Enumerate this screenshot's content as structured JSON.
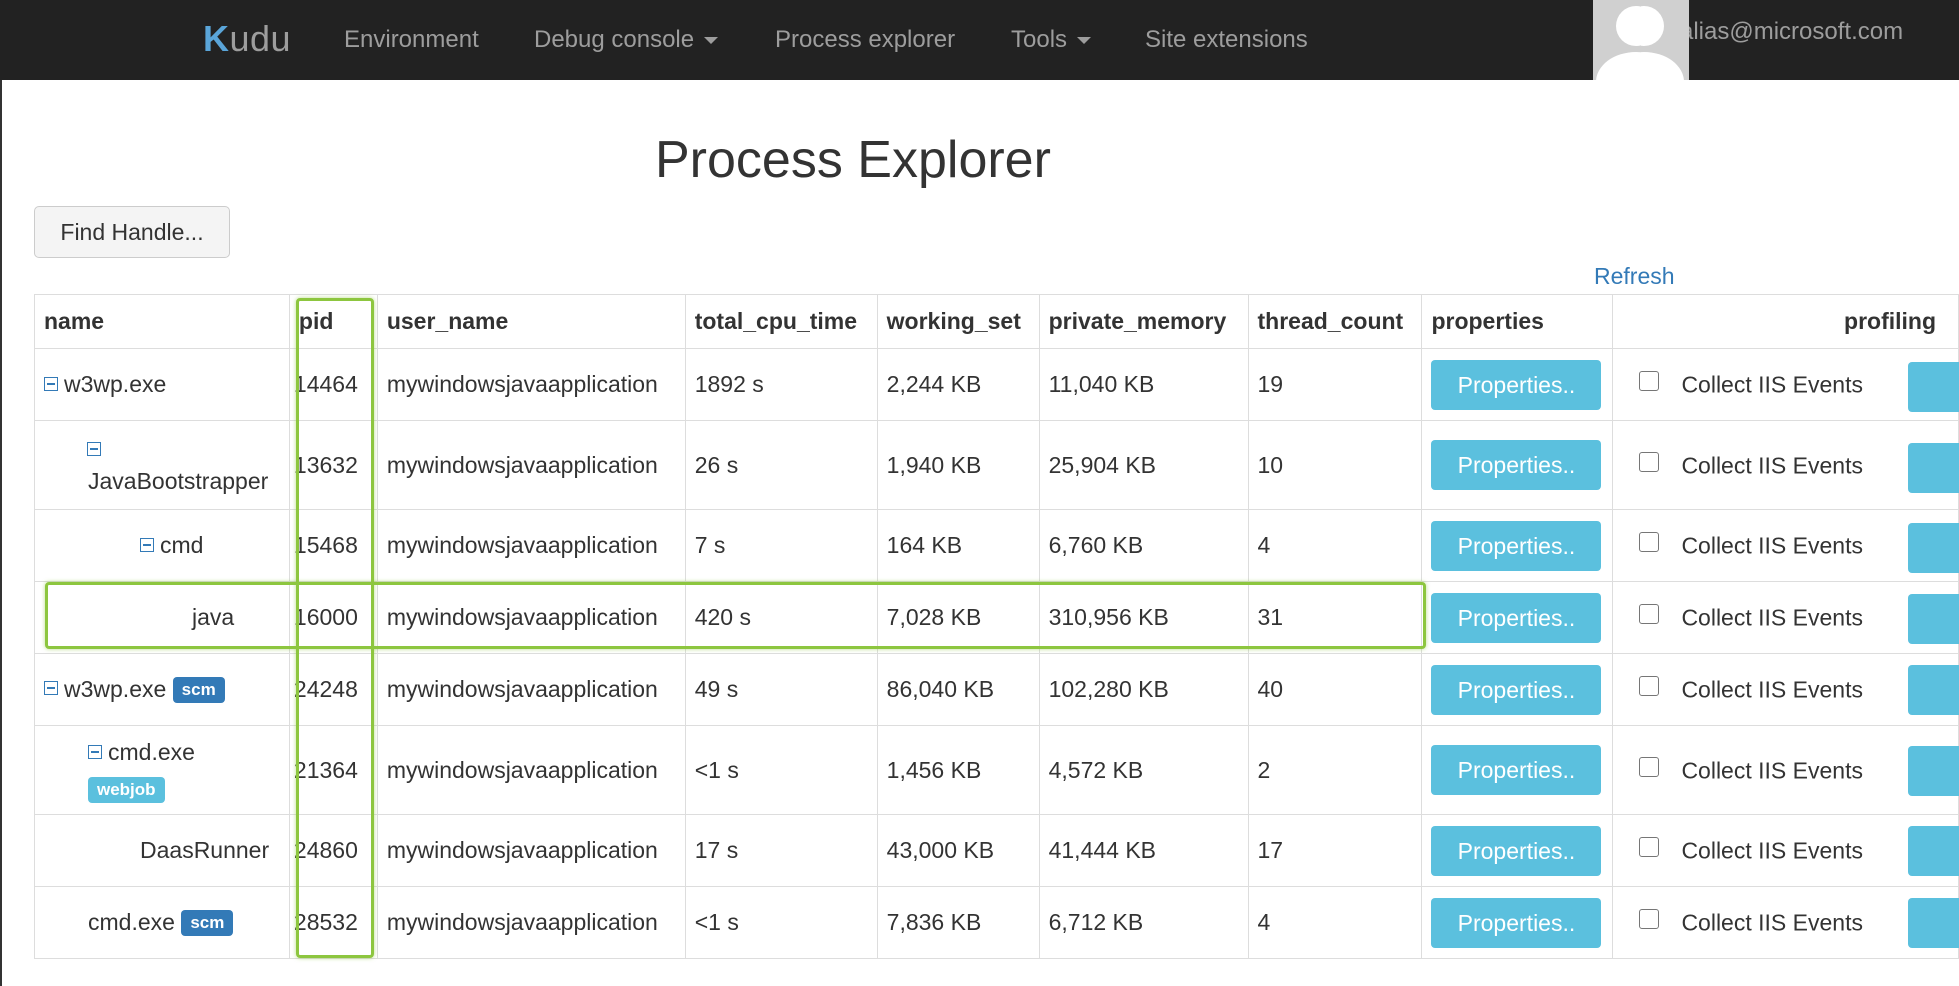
{
  "nav": {
    "brand_k": "K",
    "brand_rest": "udu",
    "items": [
      {
        "label": "Environment",
        "dropdown": false
      },
      {
        "label": "Debug console",
        "dropdown": true
      },
      {
        "label": "Process explorer",
        "dropdown": false
      },
      {
        "label": "Tools",
        "dropdown": true
      },
      {
        "label": "Site extensions",
        "dropdown": false
      }
    ],
    "user_email": "alias@microsoft.com",
    "avatar_icon": "user-silhouette-icon"
  },
  "page": {
    "title": "Process Explorer",
    "find_handle_label": "Find Handle...",
    "refresh_label": "Refresh"
  },
  "table": {
    "headers": [
      "name",
      "pid",
      "user_name",
      "total_cpu_time",
      "working_set",
      "private_memory",
      "thread_count",
      "properties",
      "profiling"
    ],
    "properties_label": "Properties..",
    "collect_label": "Collect IIS Events",
    "rows": [
      {
        "name": "w3wp.exe",
        "badge": "",
        "pid": "14464",
        "user": "mywindowsjavaapplication",
        "cpu": "1892 s",
        "ws": "2,244 KB",
        "pm": "11,040 KB",
        "threads": "19",
        "toggle": true
      },
      {
        "name": "JavaBootstrapper",
        "badge": "",
        "pid": "13632",
        "user": "mywindowsjavaapplication",
        "cpu": "26 s",
        "ws": "1,940 KB",
        "pm": "25,904 KB",
        "threads": "10",
        "toggle": true
      },
      {
        "name": "cmd",
        "badge": "",
        "pid": "15468",
        "user": "mywindowsjavaapplication",
        "cpu": "7 s",
        "ws": "164 KB",
        "pm": "6,760 KB",
        "threads": "4",
        "toggle": true
      },
      {
        "name": "java",
        "badge": "",
        "pid": "16000",
        "user": "mywindowsjavaapplication",
        "cpu": "420 s",
        "ws": "7,028 KB",
        "pm": "310,956 KB",
        "threads": "31",
        "toggle": false
      },
      {
        "name": "w3wp.exe",
        "badge": "scm",
        "pid": "24248",
        "user": "mywindowsjavaapplication",
        "cpu": "49 s",
        "ws": "86,040 KB",
        "pm": "102,280 KB",
        "threads": "40",
        "toggle": true
      },
      {
        "name": "cmd.exe",
        "badge": "webjob",
        "pid": "21364",
        "user": "mywindowsjavaapplication",
        "cpu": "<1 s",
        "ws": "1,456 KB",
        "pm": "4,572 KB",
        "threads": "2",
        "toggle": true
      },
      {
        "name": "DaasRunner",
        "badge": "",
        "pid": "24860",
        "user": "mywindowsjavaapplication",
        "cpu": "17 s",
        "ws": "43,000 KB",
        "pm": "41,444 KB",
        "threads": "17",
        "toggle": false
      },
      {
        "name": "cmd.exe",
        "badge": "scm",
        "pid": "28532",
        "user": "mywindowsjavaapplication",
        "cpu": "<1 s",
        "ws": "7,836 KB",
        "pm": "6,712 KB",
        "threads": "4",
        "toggle": false
      }
    ]
  },
  "colors": {
    "navbar": "#222222",
    "nav_text": "#9d9d9d",
    "link": "#337ab7",
    "info_button": "#5bc0de",
    "scm_badge": "#337ab7",
    "webjob_badge": "#5bc0de",
    "highlight": "#8dc63f"
  }
}
